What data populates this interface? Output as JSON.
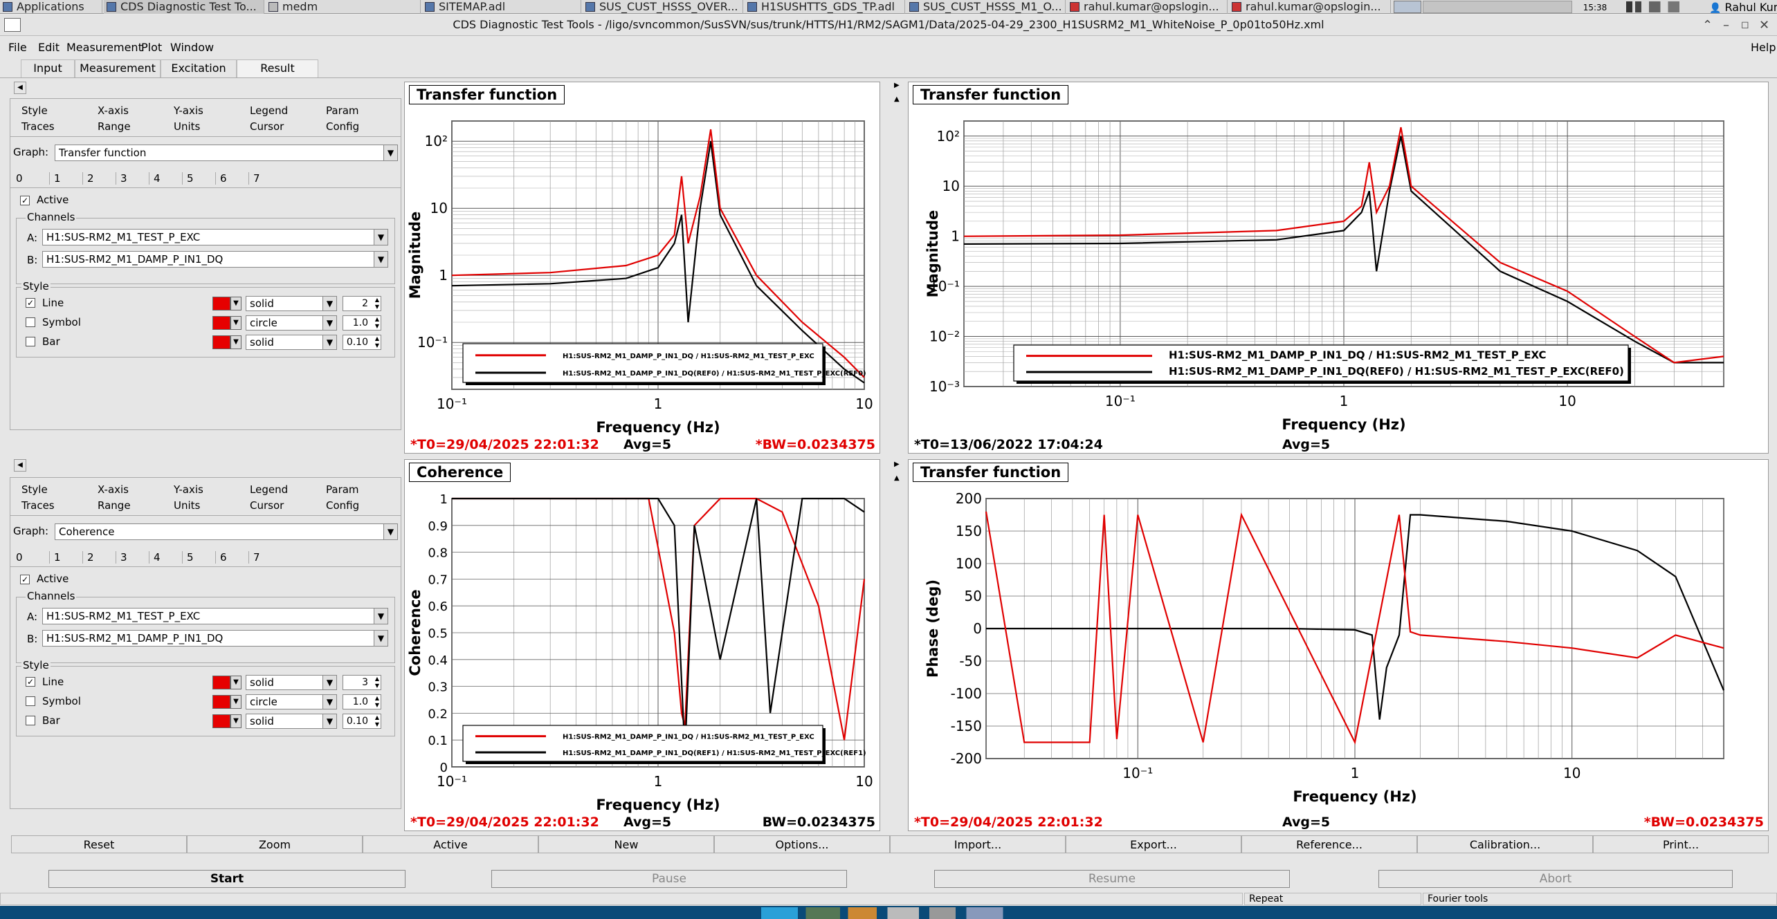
{
  "taskbar": {
    "apps": "Applications",
    "items": [
      "CDS Diagnostic Test To...",
      "medm",
      "SITEMAP.adl",
      "SUS_CUST_HSSS_OVER...",
      "H1SUSHTTS_GDS_TP.adl",
      "SUS_CUST_HSSS_M1_O...",
      "rahul.kumar@opslogin...",
      "rahul.kumar@opslogin..."
    ],
    "clock": "15:38",
    "user": "Rahul Kumar"
  },
  "window": {
    "title": "CDS Diagnostic Test Tools - /ligo/svncommon/SusSVN/sus/trunk/HTTS/H1/RM2/SAGM1/Data/2025-04-29_2300_H1SUSRM2_M1_WhiteNoise_P_0p01to50Hz.xml"
  },
  "menu": {
    "file": "File",
    "edit": "Edit",
    "measurement": "Measurement",
    "plot": "Plot",
    "window": "Window",
    "help": "Help"
  },
  "tabs": [
    "Input",
    "Measurement",
    "Excitation",
    "Result"
  ],
  "panels": [
    {
      "row1": [
        "Style",
        "X-axis",
        "Y-axis",
        "Legend",
        "Param"
      ],
      "row2": [
        "Traces",
        "Range",
        "Units",
        "Cursor",
        "Config"
      ],
      "graph_label": "Graph:",
      "graph": "Transfer function",
      "traces": [
        "0",
        "1",
        "2",
        "3",
        "4",
        "5",
        "6",
        "7"
      ],
      "active": "Active",
      "channels_label": "Channels",
      "a_label": "A:",
      "a": "H1:SUS-RM2_M1_TEST_P_EXC",
      "b_label": "B:",
      "b": "H1:SUS-RM2_M1_DAMP_P_IN1_DQ",
      "style_label": "Style",
      "line": "Line",
      "symbol": "Symbol",
      "bar": "Bar",
      "line_style": "solid",
      "symbol_style": "circle",
      "bar_style": "solid",
      "line_w": "2",
      "symbol_w": "1.0",
      "bar_w": "0.10"
    },
    {
      "row1": [
        "Style",
        "X-axis",
        "Y-axis",
        "Legend",
        "Param"
      ],
      "row2": [
        "Traces",
        "Range",
        "Units",
        "Cursor",
        "Config"
      ],
      "graph_label": "Graph:",
      "graph": "Coherence",
      "traces": [
        "0",
        "1",
        "2",
        "3",
        "4",
        "5",
        "6",
        "7"
      ],
      "active": "Active",
      "channels_label": "Channels",
      "a_label": "A:",
      "a": "H1:SUS-RM2_M1_TEST_P_EXC",
      "b_label": "B:",
      "b": "H1:SUS-RM2_M1_DAMP_P_IN1_DQ",
      "style_label": "Style",
      "line": "Line",
      "symbol": "Symbol",
      "bar": "Bar",
      "line_style": "solid",
      "symbol_style": "circle",
      "bar_style": "solid",
      "line_w": "3",
      "symbol_w": "1.0",
      "bar_w": "0.10"
    }
  ],
  "colors": {
    "red": "#e00000",
    "black": "#000000",
    "swatch": "#e60000"
  },
  "plots": [
    {
      "title": "Transfer function",
      "ylabel": "Magnitude",
      "xlabel": "Frequency (Hz)",
      "xticks": [
        "10⁻¹",
        "1",
        "10"
      ],
      "yticks": [
        "10²",
        "10",
        "1",
        "10⁻¹"
      ],
      "legend": [
        "H1:SUS-RM2_M1_DAMP_P_IN1_DQ / H1:SUS-RM2_M1_TEST_P_EXC",
        "H1:SUS-RM2_M1_DAMP_P_IN1_DQ(REF0) / H1:SUS-RM2_M1_TEST_P_EXC(REF0)"
      ],
      "t0": "*T0=29/04/2025 22:01:32",
      "avg": "Avg=5",
      "bw": "*BW=0.0234375"
    },
    {
      "title": "Transfer function",
      "ylabel": "Magnitude",
      "xlabel": "Frequency (Hz)",
      "xticks": [
        "10⁻¹",
        "1",
        "10"
      ],
      "yticks": [
        "10²",
        "10",
        "1",
        "10⁻¹",
        "10⁻²",
        "10⁻³"
      ],
      "legend": [
        "H1:SUS-RM2_M1_DAMP_P_IN1_DQ / H1:SUS-RM2_M1_TEST_P_EXC",
        "H1:SUS-RM2_M1_DAMP_P_IN1_DQ(REF0) / H1:SUS-RM2_M1_TEST_P_EXC(REF0)"
      ],
      "t0": "*T0=13/06/2022 17:04:24",
      "avg": "Avg=5",
      "bw": ""
    },
    {
      "title": "Coherence",
      "ylabel": "Coherence",
      "xlabel": "Frequency (Hz)",
      "xticks": [
        "10⁻¹",
        "1",
        "10"
      ],
      "yticks": [
        "1",
        "0.9",
        "0.8",
        "0.7",
        "0.6",
        "0.5",
        "0.4",
        "0.3",
        "0.2",
        "0.1",
        "0"
      ],
      "legend": [
        "H1:SUS-RM2_M1_DAMP_P_IN1_DQ / H1:SUS-RM2_M1_TEST_P_EXC",
        "H1:SUS-RM2_M1_DAMP_P_IN1_DQ(REF1) / H1:SUS-RM2_M1_TEST_P_EXC(REF1)"
      ],
      "t0": "*T0=29/04/2025 22:01:32",
      "avg": "Avg=5",
      "bw": "BW=0.0234375"
    },
    {
      "title": "Transfer function",
      "ylabel": "Phase (deg)",
      "xlabel": "Frequency (Hz)",
      "xticks": [
        "10⁻¹",
        "1",
        "10"
      ],
      "yticks": [
        "200",
        "150",
        "100",
        "50",
        "0",
        "-50",
        "-100",
        "-150",
        "-200"
      ],
      "legend": [],
      "t0": "*T0=29/04/2025 22:01:32",
      "avg": "Avg=5",
      "bw": "*BW=0.0234375"
    }
  ],
  "chart_data": [
    {
      "type": "line",
      "title": "Transfer function",
      "xlabel": "Frequency (Hz)",
      "ylabel": "Magnitude",
      "xscale": "log",
      "yscale": "log",
      "xlim": [
        0.1,
        10
      ],
      "ylim": [
        0.02,
        200
      ],
      "series": [
        {
          "name": "H1:SUS-RM2_M1_DAMP_P_IN1_DQ / H1:SUS-RM2_M1_TEST_P_EXC",
          "x": [
            0.1,
            0.3,
            0.7,
            1.0,
            1.2,
            1.3,
            1.4,
            1.6,
            1.8,
            2,
            3,
            5,
            8,
            10
          ],
          "y": [
            1.0,
            1.1,
            1.4,
            2,
            4,
            30,
            3,
            15,
            150,
            10,
            1,
            0.2,
            0.06,
            0.03
          ]
        },
        {
          "name": "H1:SUS-RM2_M1_DAMP_P_IN1_DQ(REF0) / H1:SUS-RM2_M1_TEST_P_EXC(REF0)",
          "x": [
            0.1,
            0.3,
            0.7,
            1.0,
            1.2,
            1.3,
            1.4,
            1.6,
            1.8,
            2,
            3,
            5,
            8,
            10
          ],
          "y": [
            0.7,
            0.75,
            0.9,
            1.3,
            3,
            8,
            0.2,
            10,
            100,
            8,
            0.7,
            0.15,
            0.04,
            0.025
          ]
        }
      ]
    },
    {
      "type": "line",
      "title": "Transfer function",
      "xlabel": "Frequency (Hz)",
      "ylabel": "Magnitude",
      "xscale": "log",
      "yscale": "log",
      "xlim": [
        0.02,
        50
      ],
      "ylim": [
        0.001,
        200
      ],
      "series": [
        {
          "name": "H1:SUS-RM2_M1_DAMP_P_IN1_DQ / H1:SUS-RM2_M1_TEST_P_EXC",
          "x": [
            0.02,
            0.1,
            0.5,
            1.0,
            1.2,
            1.3,
            1.4,
            1.6,
            1.8,
            2,
            5,
            10,
            20,
            30,
            50
          ],
          "y": [
            1.0,
            1.05,
            1.3,
            2,
            4,
            30,
            3,
            10,
            150,
            10,
            0.3,
            0.08,
            0.01,
            0.003,
            0.004
          ]
        },
        {
          "name": "H1:SUS-RM2_M1_DAMP_P_IN1_DQ(REF0) / H1:SUS-RM2_M1_TEST_P_EXC(REF0)",
          "x": [
            0.02,
            0.1,
            0.5,
            1.0,
            1.2,
            1.3,
            1.4,
            1.6,
            1.8,
            2,
            5,
            10,
            20,
            30,
            50
          ],
          "y": [
            0.7,
            0.72,
            0.85,
            1.3,
            3,
            8,
            0.2,
            8,
            100,
            8,
            0.2,
            0.05,
            0.008,
            0.003,
            0.003
          ]
        }
      ]
    },
    {
      "type": "line",
      "title": "Coherence",
      "xlabel": "Frequency (Hz)",
      "ylabel": "Coherence",
      "xscale": "log",
      "xlim": [
        0.1,
        10
      ],
      "ylim": [
        0,
        1
      ],
      "series": [
        {
          "name": "H1:SUS-RM2_M1_DAMP_P_IN1_DQ / H1:SUS-RM2_M1_TEST_P_EXC",
          "x": [
            0.1,
            0.3,
            0.9,
            1.2,
            1.3,
            1.35,
            1.5,
            2,
            3,
            4,
            6,
            8,
            10
          ],
          "y": [
            1,
            1,
            1,
            0.5,
            0.2,
            0.15,
            0.9,
            1,
            1,
            0.95,
            0.6,
            0.1,
            0.7
          ]
        },
        {
          "name": "H1:SUS-RM2_M1_DAMP_P_IN1_DQ(REF1) / H1:SUS-RM2_M1_TEST_P_EXC(REF1)",
          "x": [
            0.1,
            0.3,
            1,
            1.2,
            1.35,
            1.5,
            2,
            3,
            3.5,
            5,
            8,
            10
          ],
          "y": [
            1,
            1,
            1,
            0.9,
            0.05,
            0.9,
            0.4,
            1,
            0.2,
            1,
            1,
            0.95
          ]
        }
      ]
    },
    {
      "type": "line",
      "title": "Transfer function",
      "xlabel": "Frequency (Hz)",
      "ylabel": "Phase (deg)",
      "xscale": "log",
      "xlim": [
        0.02,
        50
      ],
      "ylim": [
        -200,
        200
      ],
      "series": [
        {
          "name": "H1:SUS-RM2_M1_DAMP_P_IN1_DQ / H1:SUS-RM2_M1_TEST_P_EXC",
          "x": [
            0.02,
            0.03,
            0.06,
            0.07,
            0.08,
            0.1,
            0.2,
            0.3,
            1,
            1.6,
            1.8,
            2,
            5,
            10,
            20,
            30,
            50
          ],
          "y": [
            180,
            -175,
            -175,
            175,
            -170,
            175,
            -175,
            175,
            -175,
            175,
            -5,
            -10,
            -20,
            -30,
            -45,
            -10,
            -30
          ]
        },
        {
          "name": "H1:SUS-RM2_M1_DAMP_P_IN1_DQ(REF0) / H1:SUS-RM2_M1_TEST_P_EXC(REF0)",
          "x": [
            0.02,
            0.1,
            0.5,
            1,
            1.2,
            1.3,
            1.4,
            1.6,
            1.8,
            2,
            5,
            10,
            20,
            30,
            50
          ],
          "y": [
            0,
            0,
            0,
            -2,
            -10,
            -140,
            -60,
            -10,
            175,
            175,
            165,
            150,
            120,
            80,
            -95
          ]
        }
      ]
    }
  ],
  "buttons": [
    "Reset",
    "Zoom",
    "Active",
    "New",
    "Options...",
    "Import...",
    "Export...",
    "Reference...",
    "Calibration...",
    "Print..."
  ],
  "controls": [
    "Start",
    "Pause",
    "Resume",
    "Abort"
  ],
  "status": {
    "repeat": "Repeat",
    "fourier": "Fourier tools"
  }
}
